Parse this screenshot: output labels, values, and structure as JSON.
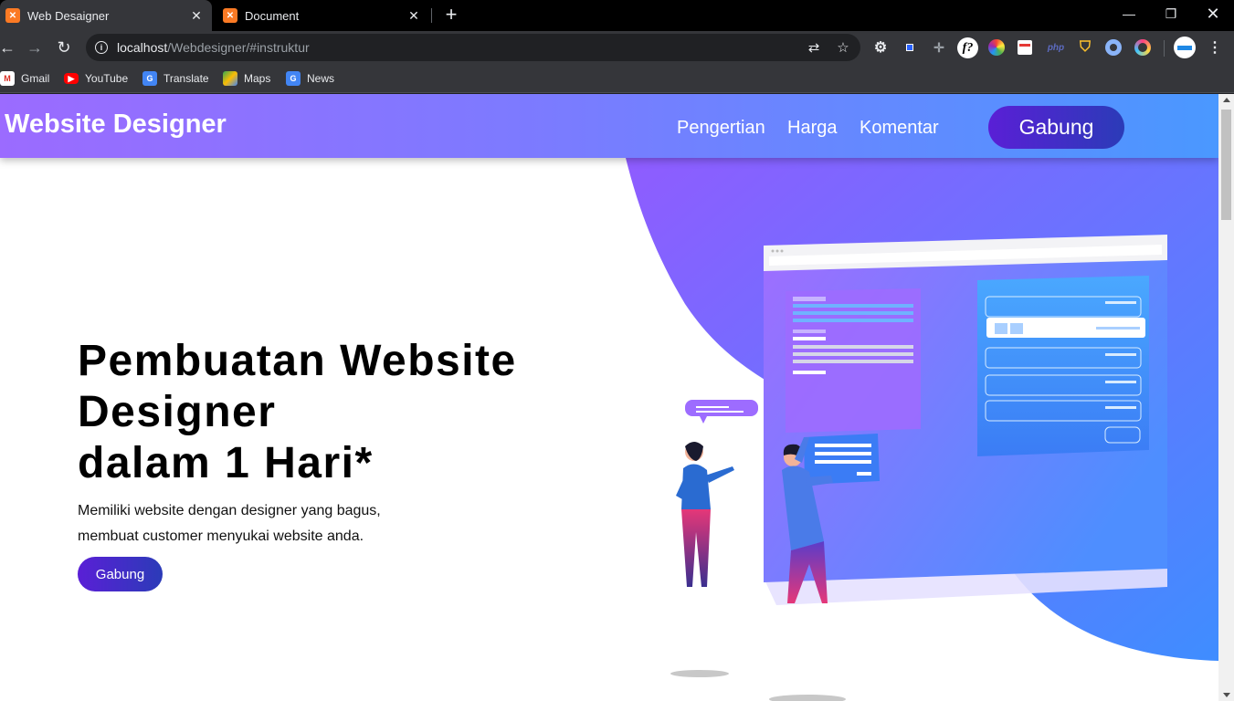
{
  "browser": {
    "tabs": [
      {
        "title": "Web Desaigner",
        "active": true
      },
      {
        "title": "Document",
        "active": false
      }
    ],
    "url": {
      "host": "localhost",
      "path": "/Webdesigner/#instruktur"
    },
    "bookmarks": [
      {
        "label": "Gmail",
        "icon": "gmail-icon"
      },
      {
        "label": "YouTube",
        "icon": "youtube-icon"
      },
      {
        "label": "Translate",
        "icon": "translate-icon"
      },
      {
        "label": "Maps",
        "icon": "maps-icon"
      },
      {
        "label": "News",
        "icon": "news-icon"
      }
    ]
  },
  "site": {
    "brand": "Website Designer",
    "nav": [
      "Pengertian",
      "Harga",
      "Komentar"
    ],
    "join_label": "Gabung",
    "hero": {
      "title_line1": "Pembuatan Website",
      "title_line2": "Designer",
      "title_line3": "dalam 1 Hari*",
      "desc_line1": "Memiliki website dengan designer yang bagus,",
      "desc_line2": "membuat customer menyukai website anda.",
      "button": "Gabung"
    },
    "colors": {
      "header_start": "#9b6bff",
      "header_end": "#4a98ff",
      "button_start": "#5a1fd6",
      "button_end": "#2b3bb8"
    }
  }
}
